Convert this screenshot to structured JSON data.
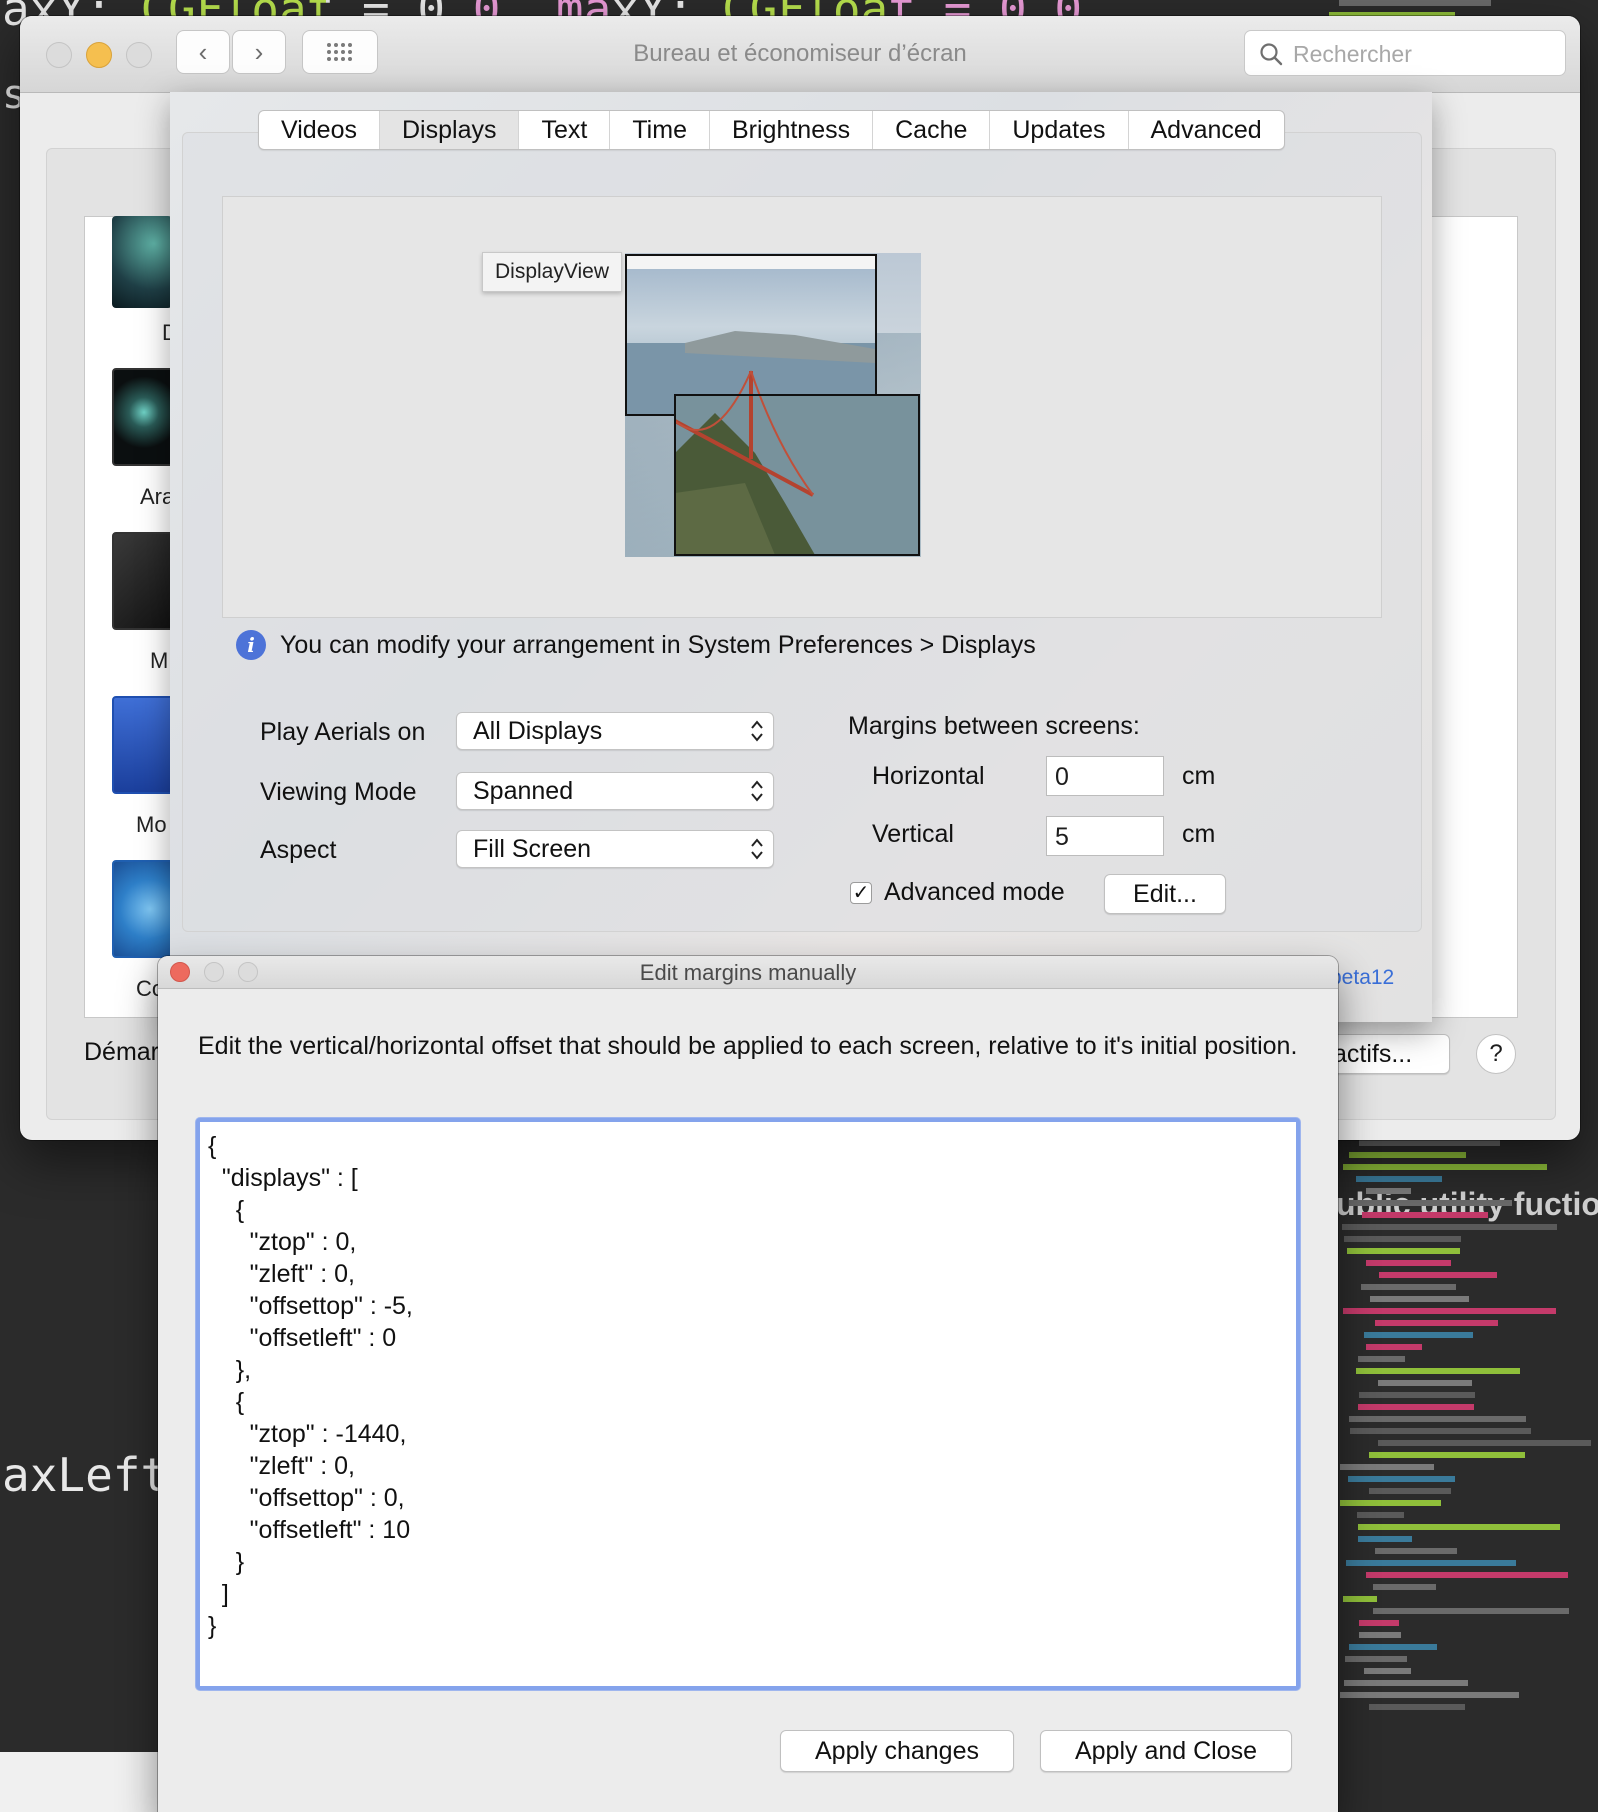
{
  "background_editor": {
    "top_line": "axY: CGFloat = 0.0, maxY: CGFloat = 0.0",
    "left_fragment_1": "s",
    "left_fragment_2": "axLeft",
    "right_comment": "ublic utility fuctio"
  },
  "sysprefs": {
    "title": "Bureau et économiseur d’écran",
    "search_placeholder": "Rechercher",
    "left_list_labels": [
      "D",
      "Ara",
      "M",
      "Mo",
      "Co"
    ],
    "bottom_left_label": "Démar",
    "bottom_right_button": "actifs...",
    "help_button": "?",
    "version_link": "beta12"
  },
  "aerial": {
    "tabs": [
      "Videos",
      "Displays",
      "Text",
      "Time",
      "Brightness",
      "Cache",
      "Updates",
      "Advanced"
    ],
    "selected_tab": "Displays",
    "tooltip": "DisplayView",
    "info_text": "You can modify your arrangement in System Preferences > Displays",
    "play_aerials_label": "Play Aerials on",
    "play_aerials_value": "All Displays",
    "viewing_mode_label": "Viewing Mode",
    "viewing_mode_value": "Spanned",
    "aspect_label": "Aspect",
    "aspect_value": "Fill Screen",
    "margins_title": "Margins between screens:",
    "horizontal_label": "Horizontal",
    "horizontal_value": "0",
    "vertical_label": "Vertical",
    "vertical_value": "5",
    "unit": "cm",
    "advanced_mode_label": "Advanced mode",
    "advanced_mode_checked": true,
    "edit_button": "Edit..."
  },
  "edit_dialog": {
    "title": "Edit margins manually",
    "description": "Edit the vertical/horizontal offset that should be applied to each screen, relative to it's initial position.",
    "json_text": "{\n  \"displays\" : [\n    {\n      \"ztop\" : 0,\n      \"zleft\" : 0,\n      \"offsettop\" : -5,\n      \"offsetleft\" : 0\n    },\n    {\n      \"ztop\" : -1440,\n      \"zleft\" : 0,\n      \"offsettop\" : 0,\n      \"offsetleft\" : 10\n    }\n  ]\n}",
    "apply_changes_button": "Apply changes",
    "apply_close_button": "Apply and Close"
  },
  "colors": {
    "close": "#ed6a5e",
    "minimize": "#f5bf4f",
    "focus_ring": "#84a3ec",
    "info_icon": "#4d73d8",
    "link": "#3a6fd8"
  }
}
